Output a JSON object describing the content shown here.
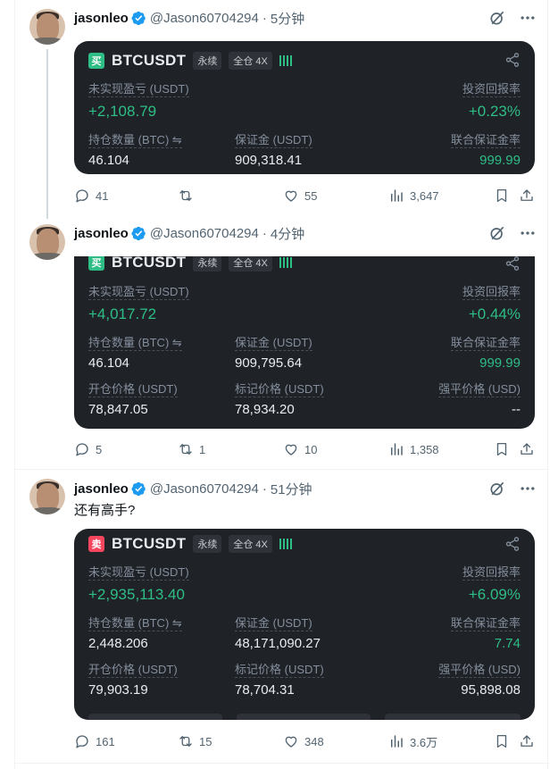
{
  "tweets": [
    {
      "name": "jasonleo",
      "handle": "@Jason60704294",
      "dot": "·",
      "time": "5分钟",
      "text": "",
      "card": {
        "side": "买",
        "symbol": "BTCUSDT",
        "tag1": "永续",
        "tag2": "全仓 4X",
        "pnl_label": "未实现盈亏 (USDT)",
        "pnl_value": "+2,108.79",
        "roi_label": "投资回报率",
        "roi_value": "+0.23%",
        "size_label": "持仓数量 (BTC) ⇋",
        "size_value": "46.104",
        "margin_label": "保证金 (USDT)",
        "margin_value": "909,318.41",
        "ratio_label": "联合保证金率",
        "ratio_value": "999.99"
      },
      "stats": {
        "replies": "41",
        "reposts": "",
        "likes": "55",
        "views": "3,647"
      }
    },
    {
      "name": "jasonleo",
      "handle": "@Jason60704294",
      "dot": "·",
      "time": "4分钟",
      "text": "",
      "card": {
        "side": "买",
        "symbol": "BTCUSDT",
        "tag1": "永续",
        "tag2": "全仓 4X",
        "pnl_label": "未实现盈亏 (USDT)",
        "pnl_value": "+4,017.72",
        "roi_label": "投资回报率",
        "roi_value": "+0.44%",
        "size_label": "持仓数量 (BTC) ⇋",
        "size_value": "46.104",
        "margin_label": "保证金 (USDT)",
        "margin_value": "909,795.64",
        "ratio_label": "联合保证金率",
        "ratio_value": "999.99",
        "entry_label": "开仓价格 (USDT)",
        "entry_value": "78,847.05",
        "mark_label": "标记价格 (USDT)",
        "mark_value": "78,934.20",
        "liq_label": "强平价格 (USD)",
        "liq_value": "--"
      },
      "stats": {
        "replies": "5",
        "reposts": "1",
        "likes": "10",
        "views": "1,358"
      }
    },
    {
      "name": "jasonleo",
      "handle": "@Jason60704294",
      "dot": "·",
      "time": "51分钟",
      "text": "还有高手?",
      "card": {
        "side": "卖",
        "symbol": "BTCUSDT",
        "tag1": "永续",
        "tag2": "全仓 4X",
        "pnl_label": "未实现盈亏 (USDT)",
        "pnl_value": "+2,935,113.40",
        "roi_label": "投资回报率",
        "roi_value": "+6.09%",
        "size_label": "持仓数量 (BTC) ⇋",
        "size_value": "2,448.206",
        "margin_label": "保证金 (USDT)",
        "margin_value": "48,171,090.27",
        "ratio_label": "联合保证金率",
        "ratio_value": "7.74",
        "entry_label": "开仓价格 (USDT)",
        "entry_value": "79,903.19",
        "mark_label": "标记价格 (USDT)",
        "mark_value": "78,704.31",
        "liq_label": "强平价格 (USD)",
        "liq_value": "95,898.08"
      },
      "stats": {
        "replies": "161",
        "reposts": "15",
        "likes": "348",
        "views": "3.6万"
      }
    }
  ],
  "colors": {
    "profit": "#2ebd85",
    "loss": "#f6465d",
    "card_bg": "#1f2227",
    "verified": "#1d9bf0"
  },
  "icons": [
    "verified-badge-icon",
    "grok-icon",
    "more-icon",
    "share-icon",
    "reply-icon",
    "repost-icon",
    "like-icon",
    "views-icon",
    "bookmark-icon",
    "upload-icon"
  ]
}
